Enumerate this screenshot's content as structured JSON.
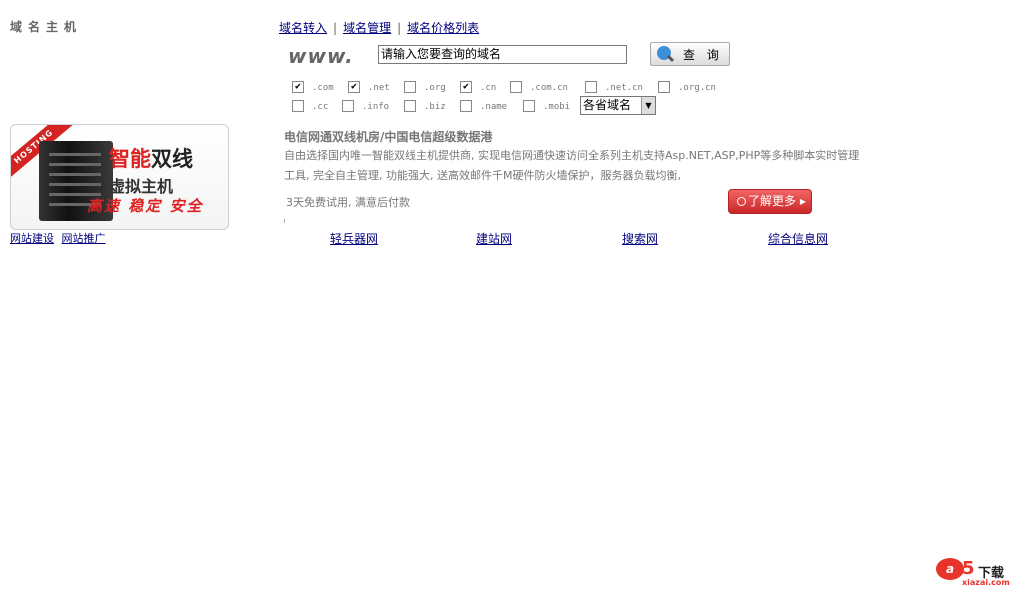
{
  "sidebar": {
    "title": "域名主机",
    "promo": {
      "ribbon": "HOSTING",
      "line1_a": "智能",
      "line1_b": "双线",
      "line2": "虚拟主机",
      "line3": "高速 稳定 安全"
    },
    "links": [
      "网站建设",
      "网站推广"
    ]
  },
  "topnav": {
    "links": [
      "域名转入",
      "域名管理",
      "域名价格列表"
    ],
    "sep": "|"
  },
  "search": {
    "prefix": "www.",
    "value": "请输入您要查询的域名",
    "button": "查 询"
  },
  "tlds": [
    {
      "label": ".com",
      "checked": true
    },
    {
      "label": ".net",
      "checked": true
    },
    {
      "label": ".org",
      "checked": false
    },
    {
      "label": ".cn",
      "checked": true
    },
    {
      "label": ".com.cn",
      "checked": false
    },
    {
      "label": ".net.cn",
      "checked": false
    },
    {
      "label": ".org.cn",
      "checked": false
    },
    {
      "label": ".cc",
      "checked": false
    },
    {
      "label": ".info",
      "checked": false
    },
    {
      "label": ".biz",
      "checked": false
    },
    {
      "label": ".name",
      "checked": false
    },
    {
      "label": ".mobi",
      "checked": false
    }
  ],
  "select": {
    "value": "各省域名"
  },
  "hosting": {
    "heading": "电信网通双线机房/中国电信超级数据港",
    "desc": "自由选择国内唯一智能双线主机提供商, 实现电信网通快速访问全系列主机支持Asp.NET,ASP,PHP等多种脚本实时管理工具, 完全自主管理, 功能强大, 送高效邮件千M硬件防火墙保护，服务器负载均衡,",
    "trial": "3天免费试用, 满意后付款",
    "more_button": "了解更多"
  },
  "bottom_links": [
    "轻兵器网",
    "建站网",
    "搜索网",
    "综合信息网"
  ],
  "watermark": {
    "circle": "a",
    "digit": "5",
    "text": "下载",
    "url": "xiazai.com"
  }
}
